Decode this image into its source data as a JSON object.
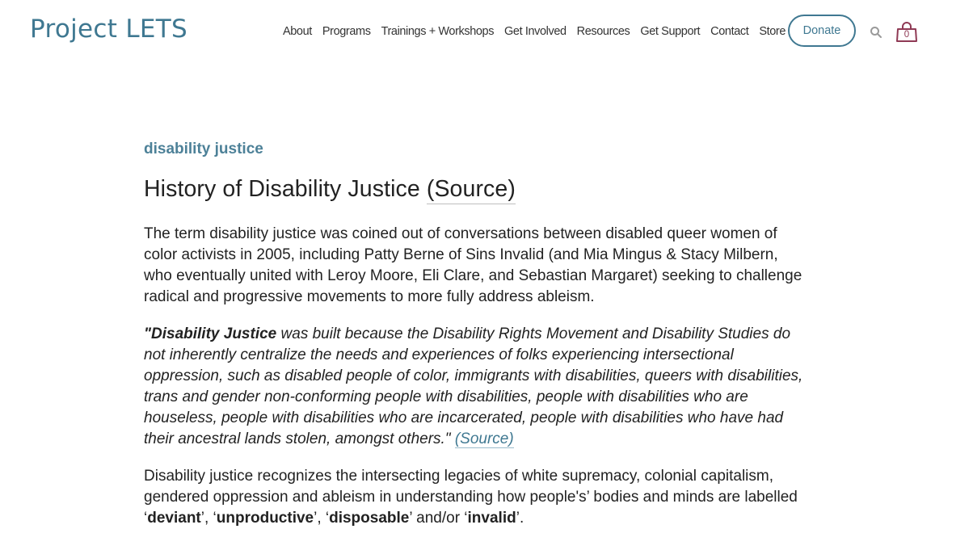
{
  "header": {
    "logo": "Project LETS",
    "nav": [
      "About",
      "Programs",
      "Trainings + Workshops",
      "Get Involved",
      "Resources",
      "Get Support",
      "Contact",
      "Store"
    ],
    "donate_label": "Donate",
    "cart_count": "0"
  },
  "article": {
    "kicker": "disability justice",
    "title": "History of Disability Justice",
    "title_source": "(Source)",
    "p1": "The term disability justice was coined out of conversations between disabled queer women of color activists in 2005, including Patty Berne of Sins Invalid (and Mia Mingus & Stacy Milbern, who eventually united with Leroy Moore, Eli Clare, and Sebastian Margaret) seeking to challenge radical and progressive movements to more fully address ableism.",
    "quote_bold": "\"Disability Justice",
    "quote_rest": " was built because the Disability Rights Movement and Disability Studies do not inherently centralize the needs and experiences of folks experiencing intersectional oppression, such as disabled people of color, immigrants with disabilities, queers with disabilities, trans and gender non-conforming people with disabilities, people with disabilities who are houseless, people with disabilities who are incarcerated, people with disabilities who have had their ancestral lands stolen, amongst others.\" ",
    "quote_source": "(Source)",
    "p3_start": "Disability justice recognizes the intersecting legacies of white supremacy, colonial capitalism, gendered oppression and ableism in understanding how people's’ bodies and minds are labelled ‘",
    "w1": "deviant",
    "sep1": "’, ‘",
    "w2": "unproductive",
    "sep2": "’, ‘",
    "w3": "disposable",
    "sep3": "’ and/or ‘",
    "w4": "invalid",
    "end": "’."
  },
  "colors": {
    "brand": "#3f7891",
    "cart": "#8f3a55"
  }
}
